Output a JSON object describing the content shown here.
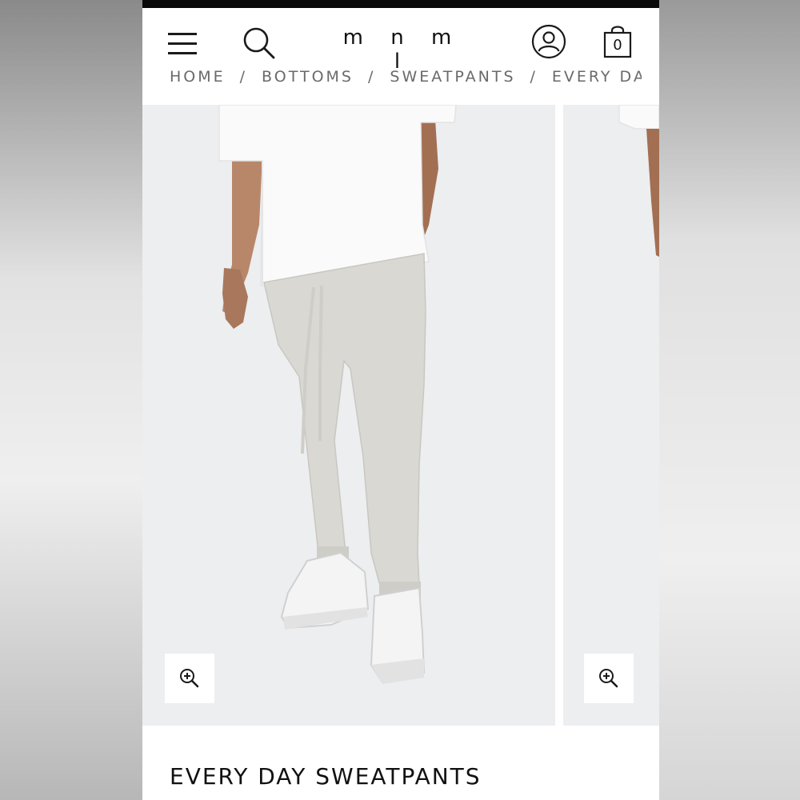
{
  "header": {
    "logo": "m n m l",
    "cart_count": "0",
    "icons": {
      "menu": "hamburger-menu-icon",
      "search": "search-icon",
      "account": "user-account-icon",
      "cart": "shopping-bag-icon"
    }
  },
  "breadcrumb": {
    "items": [
      "HOME",
      "BOTTOMS",
      "SWEATPANTS",
      "EVERY DA..."
    ],
    "separator": "/"
  },
  "gallery": {
    "zoom_icon": "zoom-in-icon"
  },
  "product": {
    "title": "EVERY DAY SWEATPANTS"
  },
  "colors": {
    "background": "#ffffff",
    "image_bg": "#eceef0",
    "text": "#111111"
  }
}
